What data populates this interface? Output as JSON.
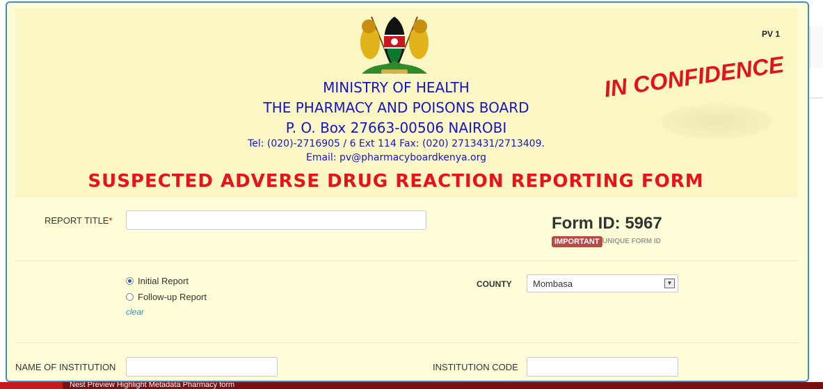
{
  "header": {
    "form_code": "PV 1",
    "ministry": "MINISTRY OF HEALTH",
    "board": "THE PHARMACY AND POISONS BOARD",
    "address": "P. O. Box 27663-00506 NAIROBI",
    "phone": "Tel: (020)-2716905 / 6 Ext 114    Fax: (020) 2713431/2713409.",
    "email": "Email: pv@pharmacyboardkenya.org",
    "stamp": "IN CONFIDENCE",
    "form_title": "SUSPECTED ADVERSE DRUG REACTION REPORTING FORM",
    "emblem_icon": "kenya-coat-of-arms"
  },
  "report": {
    "title_label": "REPORT TITLE",
    "required_mark": "*",
    "title_value": "",
    "form_id": "Form ID: 5967",
    "badge": "IMPORTANT",
    "badge_note": "UNIQUE FORM ID"
  },
  "report_type": {
    "options": [
      "Initial Report",
      "Follow-up Report"
    ],
    "selected": "Initial Report",
    "clear_label": "clear"
  },
  "county": {
    "label": "COUNTY",
    "value": "Mombasa"
  },
  "institution": {
    "name_label": "NAME OF INSTITUTION",
    "name_value": "",
    "code_label": "INSTITUTION CODE",
    "code_value": ""
  },
  "taskbar": {
    "items_text": "Nest   Preview   Highlight   Metadata   Pharmacy form"
  },
  "colors": {
    "background": "#fffdd8",
    "header_bg": "#fbf7c4",
    "blue_text": "#1414c8",
    "red_title": "#e6131b",
    "badge": "#b94a48",
    "border": "#3a8fc7"
  }
}
